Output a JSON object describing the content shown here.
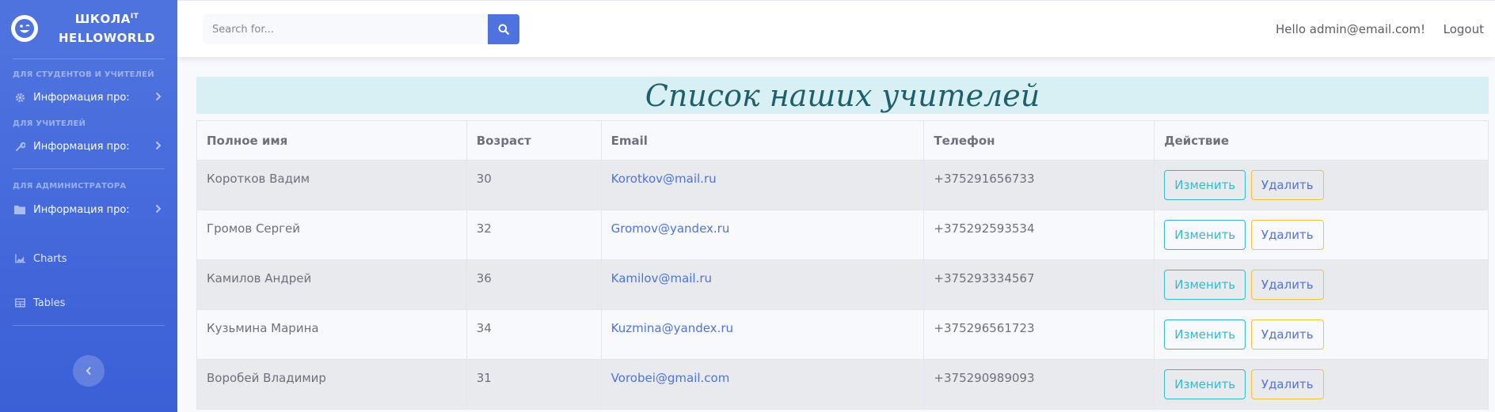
{
  "brand": {
    "line1": "ШКОЛА",
    "sup": "IT",
    "line2": "HELLOWORLD"
  },
  "sidebar": {
    "heading_students": "Для студентов и учителей",
    "heading_teachers": "Для учителей",
    "heading_admin": "Для администратора",
    "items": [
      {
        "label": "Информация про:",
        "icon": "gear-icon"
      },
      {
        "label": "Информация про:",
        "icon": "wrench-icon"
      },
      {
        "label": "Информация про:",
        "icon": "folder-icon"
      },
      {
        "label": "Charts",
        "icon": "chart-icon"
      },
      {
        "label": "Tables",
        "icon": "table-icon"
      }
    ]
  },
  "topbar": {
    "search_placeholder": "Search for...",
    "greeting": "Hello admin@email.com!",
    "logout": "Logout"
  },
  "page_title": "Список наших учителей",
  "table": {
    "headers": [
      "Полное имя",
      "Возраст",
      "Email",
      "Телефон",
      "Действие"
    ],
    "rows": [
      {
        "name": "Коротков Вадим",
        "age": "30",
        "email": "Korotkov@mail.ru",
        "phone": "+375291656733",
        "edit": "Изменить",
        "delete": "Удалить"
      },
      {
        "name": "Громов Сергей",
        "age": "32",
        "email": "Gromov@yandex.ru",
        "phone": "+375292593534",
        "edit": "Изменить",
        "delete": "Удалить"
      },
      {
        "name": "Камилов Андрей",
        "age": "36",
        "email": "Kamilov@mail.ru",
        "phone": "+375293334567",
        "edit": "Изменить",
        "delete": "Удалить"
      },
      {
        "name": "Кузьмина Марина",
        "age": "34",
        "email": "Kuzmina@yandex.ru",
        "phone": "+375296561723",
        "edit": "Изменить",
        "delete": "Удалить"
      },
      {
        "name": "Воробей Владимир",
        "age": "31",
        "email": "Vorobei@gmail.com",
        "phone": "+375290989093",
        "edit": "Изменить",
        "delete": "Удалить"
      }
    ]
  },
  "colors": {
    "sidebar": "#4e73df",
    "accent": "#4e73df",
    "edit": "#36b9cc",
    "delete": "#f6c23e",
    "title_bg": "#d8f0f4"
  }
}
